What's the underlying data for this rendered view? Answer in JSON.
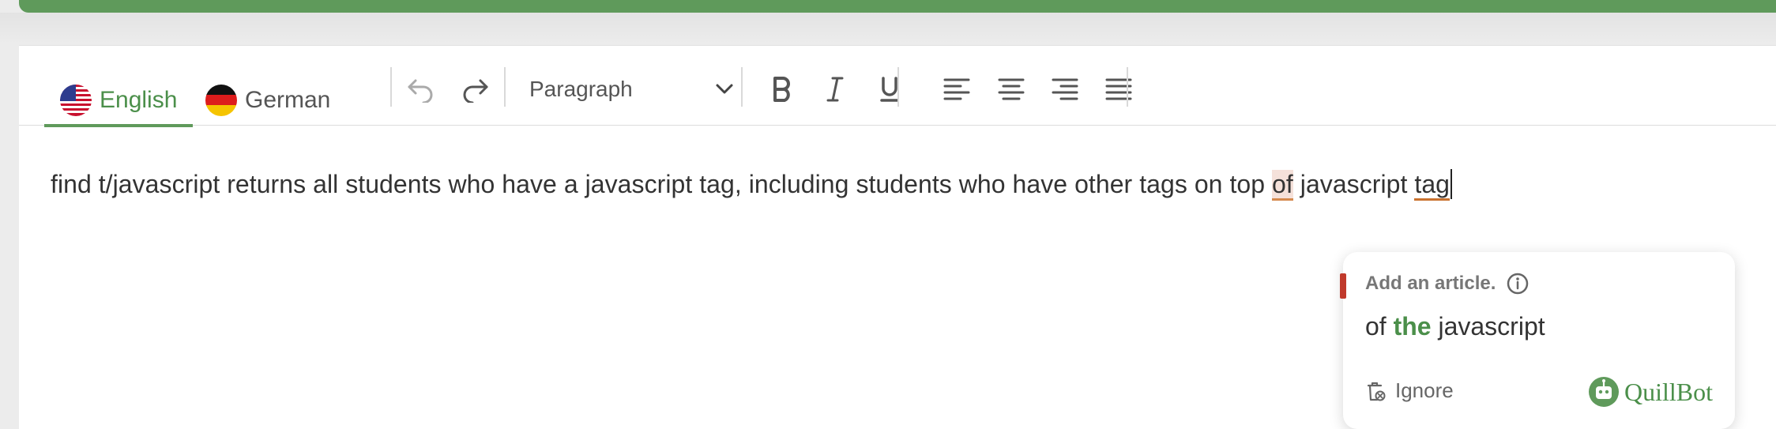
{
  "languages": [
    {
      "label": "English",
      "flag": "us-flag-icon",
      "active": true
    },
    {
      "label": "German",
      "flag": "de-flag-icon",
      "active": false
    }
  ],
  "toolbar": {
    "undo_icon": "undo-icon",
    "redo_icon": "redo-icon",
    "block_format": "Paragraph",
    "bold_icon": "bold-icon",
    "italic_icon": "italic-icon",
    "underline_icon": "underline-icon",
    "align_left_icon": "align-left-icon",
    "align_center_icon": "align-center-icon",
    "align_right_icon": "align-right-icon",
    "justify_icon": "justify-icon"
  },
  "editor": {
    "text_before": "find t/javascript returns all students who have a javascript tag, including students who have other tags on top ",
    "flagged_word": "of",
    "text_middle": " javascript ",
    "flagged_word_2": "tag"
  },
  "suggestion_popup": {
    "title": "Add an article.",
    "before": "of ",
    "inserted": "the",
    "after": " javascript",
    "ignore_label": "Ignore",
    "brand": "QuillBot"
  },
  "colors": {
    "accent": "#5f9a5b",
    "error_marker": "#c0392b",
    "highlight": "#f5e1da"
  }
}
